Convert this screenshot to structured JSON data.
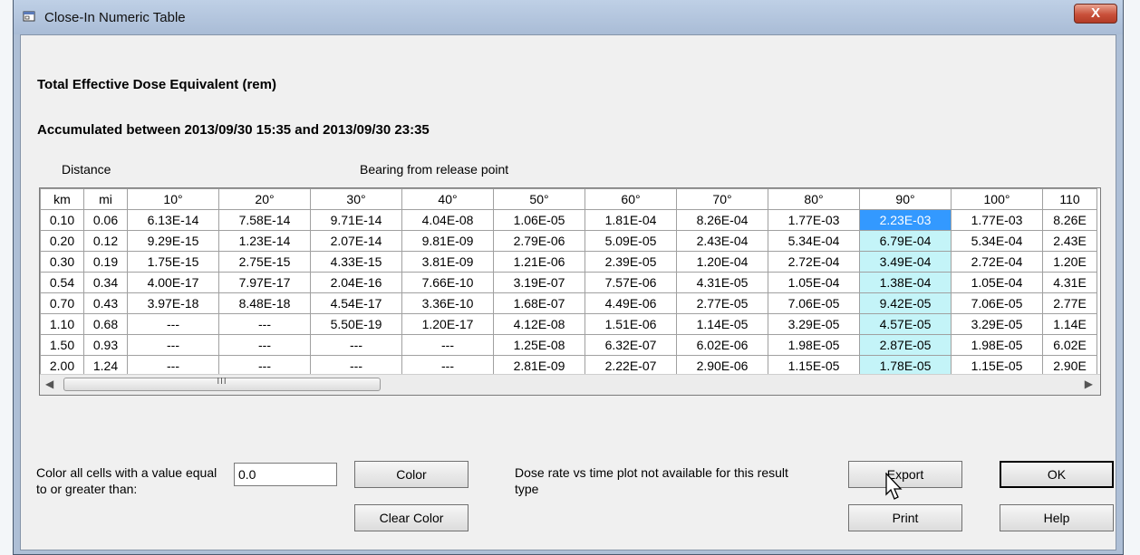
{
  "window": {
    "title": "Close-In Numeric Table",
    "close_label": "X"
  },
  "headings": {
    "line1": "Total Effective Dose Equivalent (rem)",
    "line2": "Accumulated between 2013/09/30 15:35 and 2013/09/30 23:35"
  },
  "grid_labels": {
    "distance": "Distance",
    "bearing": "Bearing from release point"
  },
  "table": {
    "columns": [
      "km",
      "mi",
      "10°",
      "20°",
      "30°",
      "40°",
      "50°",
      "60°",
      "70°",
      "80°",
      "90°",
      "100°",
      "110"
    ],
    "rows": [
      [
        "0.10",
        "0.06",
        "6.13E-14",
        "7.58E-14",
        "9.71E-14",
        "4.04E-08",
        "1.06E-05",
        "1.81E-04",
        "8.26E-04",
        "1.77E-03",
        "2.23E-03",
        "1.77E-03",
        "8.26E"
      ],
      [
        "0.20",
        "0.12",
        "9.29E-15",
        "1.23E-14",
        "2.07E-14",
        "9.81E-09",
        "2.79E-06",
        "5.09E-05",
        "2.43E-04",
        "5.34E-04",
        "6.79E-04",
        "5.34E-04",
        "2.43E"
      ],
      [
        "0.30",
        "0.19",
        "1.75E-15",
        "2.75E-15",
        "4.33E-15",
        "3.81E-09",
        "1.21E-06",
        "2.39E-05",
        "1.20E-04",
        "2.72E-04",
        "3.49E-04",
        "2.72E-04",
        "1.20E"
      ],
      [
        "0.54",
        "0.34",
        "4.00E-17",
        "7.97E-17",
        "2.04E-16",
        "7.66E-10",
        "3.19E-07",
        "7.57E-06",
        "4.31E-05",
        "1.05E-04",
        "1.38E-04",
        "1.05E-04",
        "4.31E"
      ],
      [
        "0.70",
        "0.43",
        "3.97E-18",
        "8.48E-18",
        "4.54E-17",
        "3.36E-10",
        "1.68E-07",
        "4.49E-06",
        "2.77E-05",
        "7.06E-05",
        "9.42E-05",
        "7.06E-05",
        "2.77E"
      ],
      [
        "1.10",
        "0.68",
        "---",
        "---",
        "5.50E-19",
        "1.20E-17",
        "4.12E-08",
        "1.51E-06",
        "1.14E-05",
        "3.29E-05",
        "4.57E-05",
        "3.29E-05",
        "1.14E"
      ],
      [
        "1.50",
        "0.93",
        "---",
        "---",
        "---",
        "---",
        "1.25E-08",
        "6.32E-07",
        "6.02E-06",
        "1.98E-05",
        "2.87E-05",
        "1.98E-05",
        "6.02E"
      ],
      [
        "2.00",
        "1.24",
        "---",
        "---",
        "---",
        "---",
        "2.81E-09",
        "2.22E-07",
        "2.90E-06",
        "1.15E-05",
        "1.78E-05",
        "1.15E-05",
        "2.90E"
      ]
    ],
    "highlight_column": 10,
    "selected_row": 0,
    "colors": {
      "selected": "#3399ff",
      "highlight": "#c4f4f8",
      "header_bg": "#ffffff",
      "cell_bg": "#ffffff"
    }
  },
  "scrollbar": {
    "left_arrow": "◀",
    "right_arrow": "▶",
    "thumb_grip": "III"
  },
  "color_control": {
    "label": "Color all cells with a value equal to or greater than:",
    "value": "0.0",
    "color_button": "Color",
    "clear_button": "Clear Color"
  },
  "note": "Dose rate vs time plot not available for this result type",
  "buttons": {
    "export": "Export",
    "print": "Print",
    "ok": "OK",
    "help": "Help"
  },
  "icons": {
    "title": "window-app-icon",
    "cursor": "mouse-pointer-icon"
  }
}
